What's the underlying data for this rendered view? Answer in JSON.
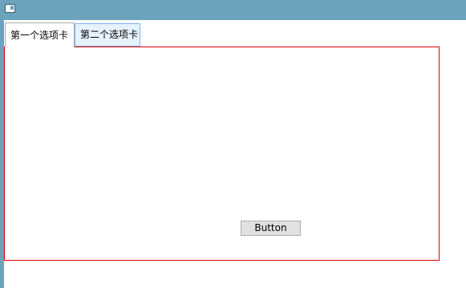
{
  "tabs": [
    {
      "label": "第一个选项卡",
      "selected": true
    },
    {
      "label": "第二个选项卡",
      "selected": false
    }
  ],
  "content": {
    "button_label": "Button"
  },
  "colors": {
    "titlebar": "#6ba3bd",
    "content_border": "#e00000",
    "hover_tab_bg": "#e6f2fc",
    "hover_tab_border": "#7eb4ea",
    "button_bg": "#e1e1e1"
  }
}
